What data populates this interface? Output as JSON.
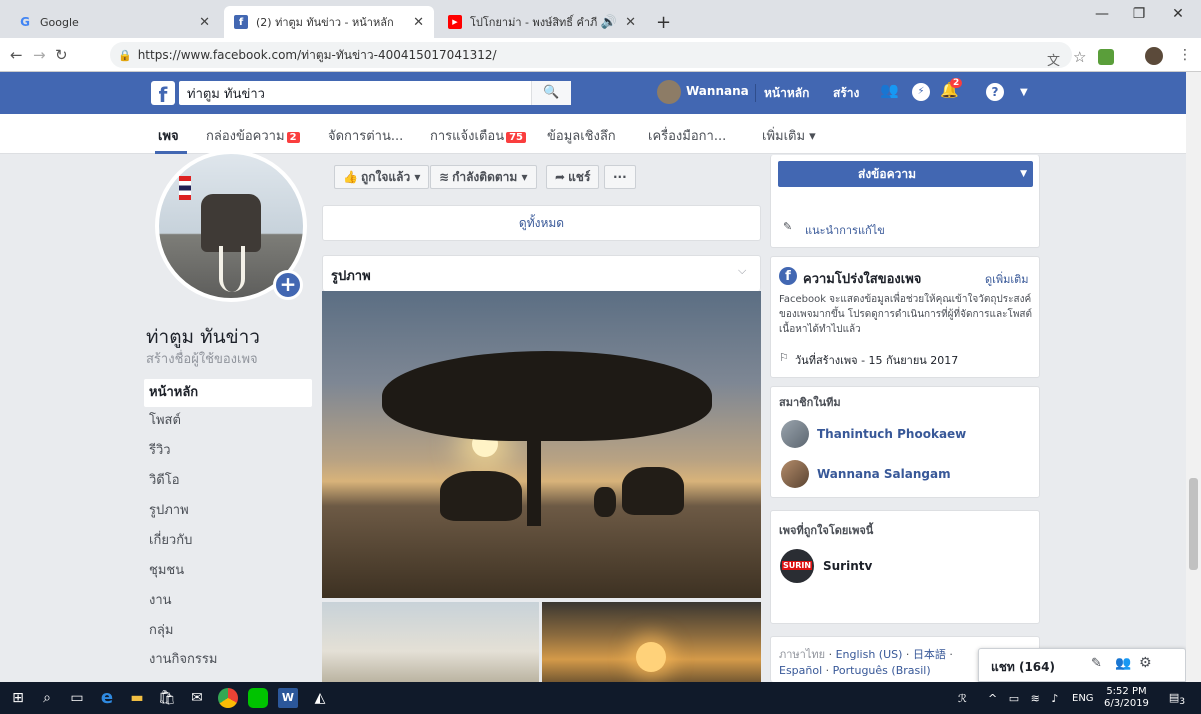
{
  "browser": {
    "tabs": [
      {
        "title": "Google",
        "icon": "google-icon",
        "color": "#4285f4"
      },
      {
        "title": "(2) ท่าตูม ทันข่าว - หน้าหลัก",
        "icon": "facebook-icon",
        "color": "#4267b2"
      },
      {
        "title": "โปโกยาม่า - พงษ์สิทธิ์ คำภีร์ - YouTube",
        "icon": "youtube-icon",
        "color": "#ff0000"
      }
    ],
    "new_tab": "+",
    "url": "https://www.facebook.com/ท่าตูม-ทันข่าว-400415017041312/"
  },
  "fb_header": {
    "logo": "f",
    "search_value": "ท่าตูม ทันข่าว",
    "user_name": "Wannana",
    "home": "หน้าหลัก",
    "create": "สร้าง",
    "notif_badge": "2",
    "brand_color": "#4267b2"
  },
  "page_nav": {
    "items": [
      {
        "label": "เพจ",
        "badge": ""
      },
      {
        "label": "กล่องข้อความ",
        "badge": "2"
      },
      {
        "label": "จัดการต่าน...",
        "badge": ""
      },
      {
        "label": "การแจ้งเตือน",
        "badge": "75"
      },
      {
        "label": "ข้อมูลเชิงลึก",
        "badge": ""
      },
      {
        "label": "เครื่องมือกา...",
        "badge": ""
      },
      {
        "label": "เพิ่มเติม ▾",
        "badge": ""
      }
    ]
  },
  "page_profile": {
    "name": "ท่าตูม ทันข่าว",
    "create_username": "สร้างชื่อผู้ใช้ของเพจ"
  },
  "left_nav": [
    "หน้าหลัก",
    "โพสต์",
    "รีวิว",
    "วิดีโอ",
    "รูปภาพ",
    "เกี่ยวกับ",
    "ชุมชน",
    "งาน",
    "กลุ่ม",
    "งานกิจกรรม"
  ],
  "actions": {
    "liked": "ถูกใจแล้ว ▾",
    "following": "กำลังติดตาม ▾",
    "share": "แชร์",
    "more": "···",
    "send_message": "ส่งข้อความ",
    "see_all": "ดูทั้งหมด",
    "suggest_edit": "แนะนำการแก้ไข"
  },
  "photos_card": {
    "title": "รูปภาพ"
  },
  "transparency": {
    "title": "ความโปร่งใสของเพจ",
    "see_more": "ดูเพิ่มเติม",
    "description": "Facebook จะแสดงข้อมูลเพื่อช่วยให้คุณเข้าใจวัตถุประสงค์ของเพจมากขึ้น โปรดดูการดำเนินการที่ผู้ที่จัดการและโพสต์เนื้อหาได้ทำไปแล้ว",
    "created": "วันที่สร้างเพจ - 15 กันยายน 2017"
  },
  "team": {
    "title": "สมาชิกในทีม",
    "members": [
      "Thanintuch Phookaew",
      "Wannana Salangam"
    ]
  },
  "liked_pages": {
    "title": "เพจที่ถูกใจโดยเพจนี้",
    "pages": [
      {
        "name": "Surintv",
        "logo": "SURIN"
      }
    ]
  },
  "languages": {
    "current": "ภาษาไทย",
    "others": [
      "English (US)",
      "日本語",
      "Español",
      "Português (Brasil)"
    ]
  },
  "chat": {
    "label": "แชท (164)"
  },
  "taskbar": {
    "time": "5:52 PM",
    "date": "6/3/2019",
    "lang": "ENG",
    "notif_count": "3"
  }
}
